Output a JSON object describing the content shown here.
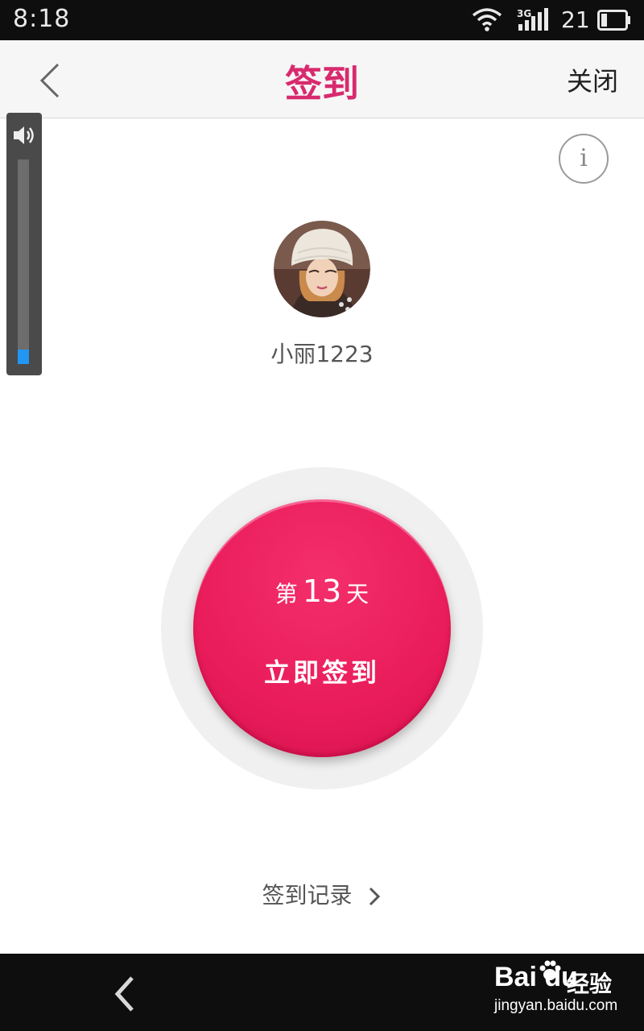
{
  "status_bar": {
    "time": "8:18",
    "network_label": "3G",
    "battery_level": "21",
    "icons": [
      "wifi-icon",
      "signal-icon",
      "battery-icon"
    ]
  },
  "header": {
    "title": "签到",
    "close_label": "关闭",
    "back_icon": "chevron-left-icon"
  },
  "volume": {
    "icon": "speaker-icon",
    "level": 0.07
  },
  "info_button": {
    "label": "i"
  },
  "profile": {
    "username": "小丽1223"
  },
  "checkin": {
    "day_prefix": "第",
    "day_number": "13",
    "day_suffix": "天",
    "button_label": "立即签到"
  },
  "record_link": {
    "label": "签到记录"
  },
  "watermark": {
    "logo_text": "Bai du",
    "jingyan_text": "经验",
    "url": "jingyan.baidu.com"
  },
  "colors": {
    "accent": "#d82a6e",
    "button": "#ea1c5b",
    "volume_fill": "#2196f3"
  }
}
